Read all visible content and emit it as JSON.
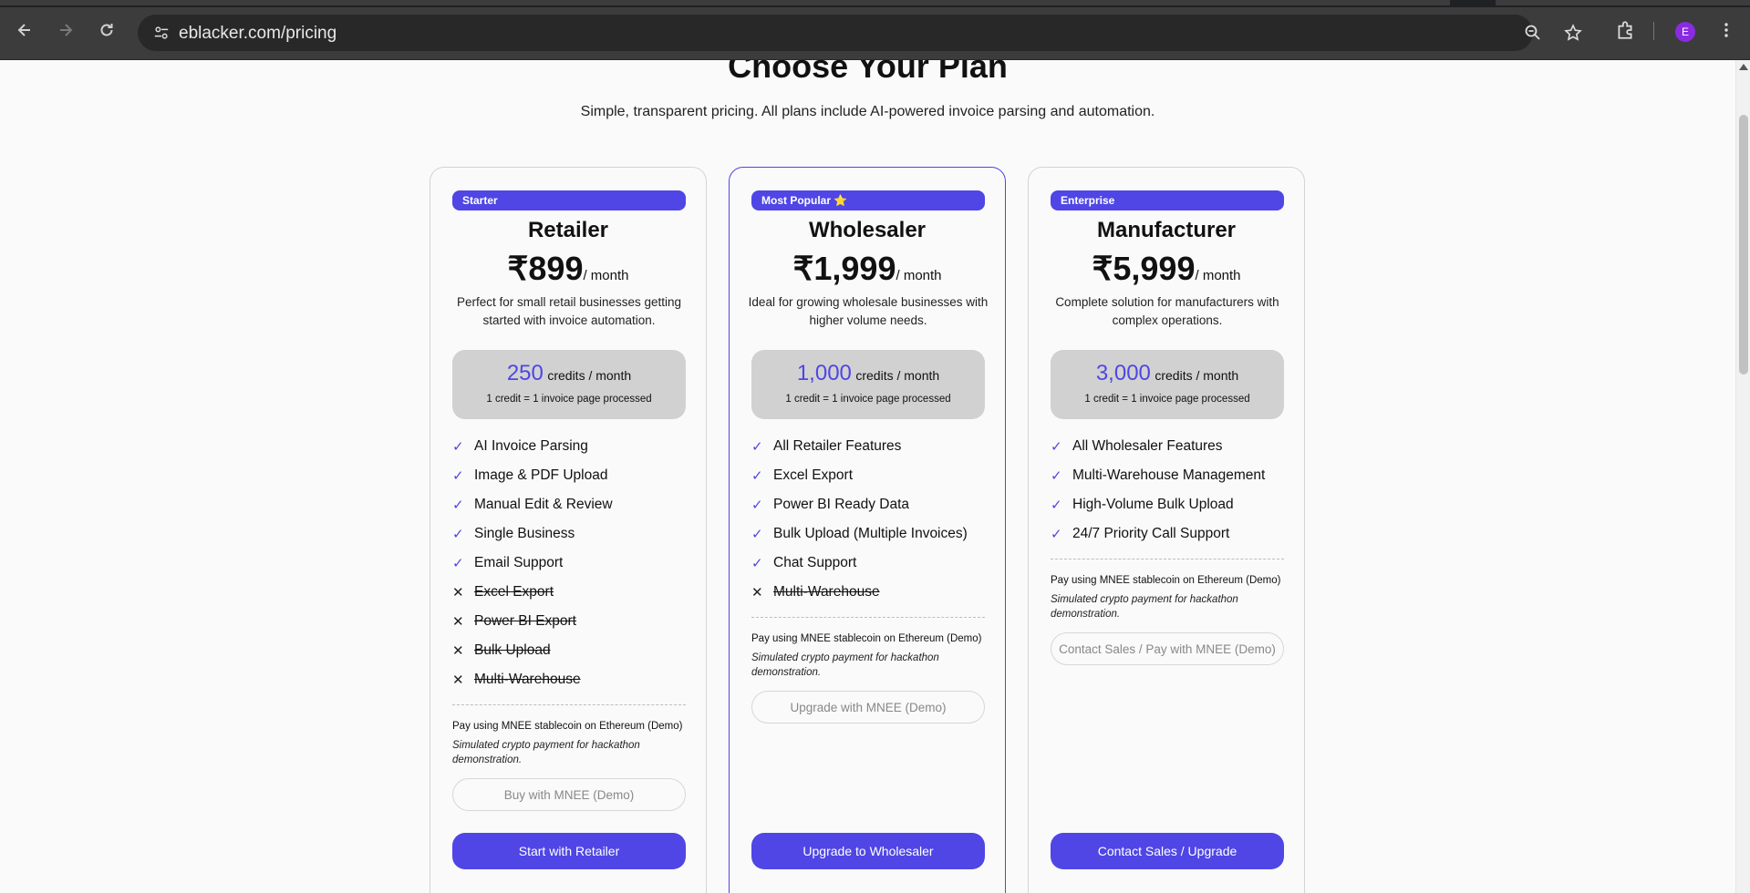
{
  "browser": {
    "url": "eblacker.com/pricing",
    "profile_initial": "E",
    "accent": "#4f46e5"
  },
  "header": {
    "title": "Choose Your Plan",
    "subtitle": "Simple, transparent pricing. All plans include AI-powered invoice parsing and automation."
  },
  "plans": [
    {
      "badge": "Starter",
      "name": "Retailer",
      "price": "₹899",
      "period": "/ month",
      "description": "Perfect for small retail businesses getting started with invoice automation.",
      "credits": "250",
      "credits_unit": "credits / month",
      "credits_note": "1 credit = 1 invoice page processed",
      "features": [
        {
          "text": "AI Invoice Parsing",
          "included": true
        },
        {
          "text": "Image & PDF Upload",
          "included": true
        },
        {
          "text": "Manual Edit & Review",
          "included": true
        },
        {
          "text": "Single Business",
          "included": true
        },
        {
          "text": "Email Support",
          "included": true
        },
        {
          "text": "Excel Export",
          "included": false
        },
        {
          "text": "Power BI Export",
          "included": false
        },
        {
          "text": "Bulk Upload",
          "included": false
        },
        {
          "text": "Multi-Warehouse",
          "included": false
        }
      ],
      "pay_note": "Pay using MNEE stablecoin on Ethereum (Demo)",
      "pay_sub": "Simulated crypto payment for hackathon demonstration.",
      "mnee_button": "Buy with MNEE (Demo)",
      "cta": "Start with Retailer"
    },
    {
      "badge": "Most Popular ⭐",
      "name": "Wholesaler",
      "price": "₹1,999",
      "period": "/ month",
      "description": "Ideal for growing wholesale businesses with higher volume needs.",
      "credits": "1,000",
      "credits_unit": "credits / month",
      "credits_note": "1 credit = 1 invoice page processed",
      "features": [
        {
          "text": "All Retailer Features",
          "included": true
        },
        {
          "text": "Excel Export",
          "included": true
        },
        {
          "text": "Power BI Ready Data",
          "included": true
        },
        {
          "text": "Bulk Upload (Multiple Invoices)",
          "included": true
        },
        {
          "text": "Chat Support",
          "included": true
        },
        {
          "text": "Multi-Warehouse",
          "included": false
        }
      ],
      "pay_note": "Pay using MNEE stablecoin on Ethereum (Demo)",
      "pay_sub": "Simulated crypto payment for hackathon demonstration.",
      "mnee_button": "Upgrade with MNEE (Demo)",
      "cta": "Upgrade to Wholesaler"
    },
    {
      "badge": "Enterprise",
      "name": "Manufacturer",
      "price": "₹5,999",
      "period": "/ month",
      "description": "Complete solution for manufacturers with complex operations.",
      "credits": "3,000",
      "credits_unit": "credits / month",
      "credits_note": "1 credit = 1 invoice page processed",
      "features": [
        {
          "text": "All Wholesaler Features",
          "included": true
        },
        {
          "text": "Multi-Warehouse Management",
          "included": true
        },
        {
          "text": "High-Volume Bulk Upload",
          "included": true
        },
        {
          "text": "24/7 Priority Call Support",
          "included": true
        }
      ],
      "pay_note": "Pay using MNEE stablecoin on Ethereum (Demo)",
      "pay_sub": "Simulated crypto payment for hackathon demonstration.",
      "mnee_button": "Contact Sales / Pay with MNEE (Demo)",
      "cta": "Contact Sales / Upgrade"
    }
  ]
}
